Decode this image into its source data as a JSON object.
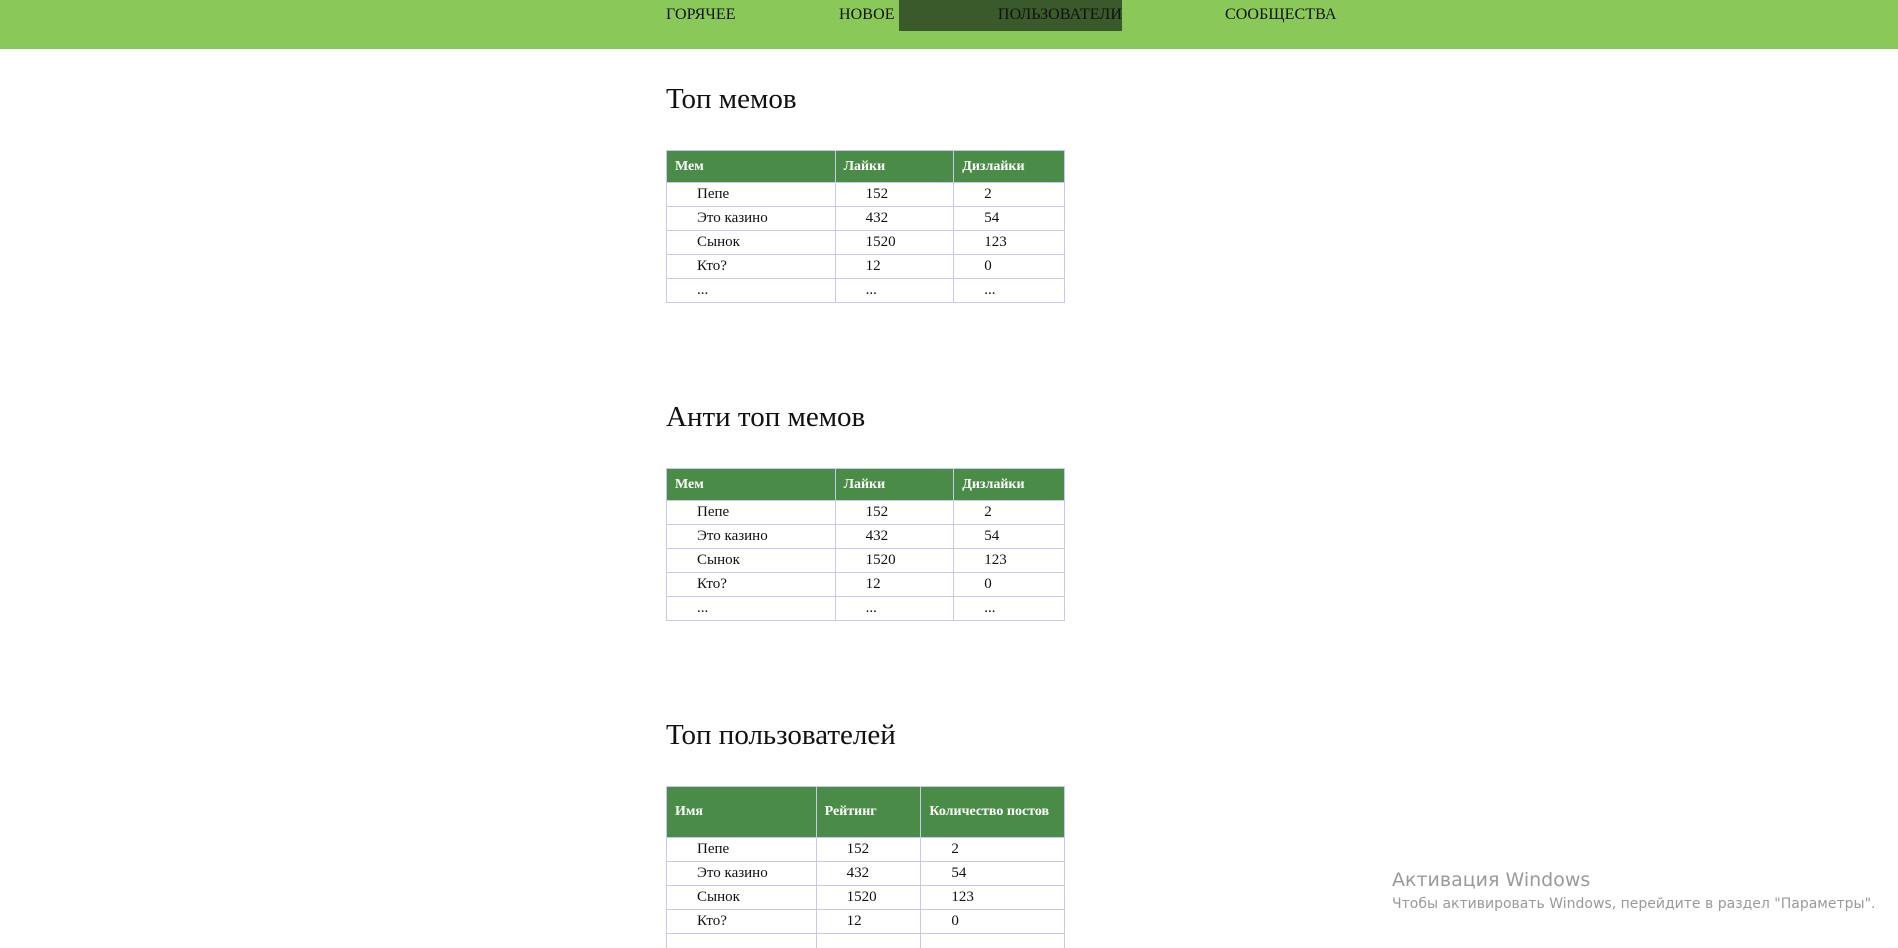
{
  "nav": {
    "items": [
      {
        "label": "ГОРЯЧЕЕ"
      },
      {
        "label": "НОВОЕ"
      },
      {
        "label": "ПОЛЬЗОВАТЕЛИ",
        "active": true
      },
      {
        "label": "СООБЩЕСТВА"
      }
    ],
    "bar_color": "#8ac85a",
    "active_color": "#3a5a2b"
  },
  "sections": [
    {
      "title": "Топ мемов",
      "headers": [
        "Мем",
        "Лайки",
        "Дизлайки"
      ],
      "rows": [
        [
          "Пепе",
          "152",
          "2"
        ],
        [
          "Это казино",
          "432",
          "54"
        ],
        [
          "Сынок",
          "1520",
          "123"
        ],
        [
          "Кто?",
          "12",
          "0"
        ],
        [
          "...",
          "...",
          "..."
        ]
      ]
    },
    {
      "title": "Анти топ мемов",
      "headers": [
        "Мем",
        "Лайки",
        "Дизлайки"
      ],
      "rows": [
        [
          "Пепе",
          "152",
          "2"
        ],
        [
          "Это казино",
          "432",
          "54"
        ],
        [
          "Сынок",
          "1520",
          "123"
        ],
        [
          "Кто?",
          "12",
          "0"
        ],
        [
          "...",
          "...",
          "..."
        ]
      ]
    },
    {
      "title": "Топ пользователей",
      "headers": [
        "Имя",
        "Рейтинг",
        "Количество постов"
      ],
      "rows": [
        [
          "Пепе",
          "152",
          "2"
        ],
        [
          "Это казино",
          "432",
          "54"
        ],
        [
          "Сынок",
          "1520",
          "123"
        ],
        [
          "Кто?",
          "12",
          "0"
        ],
        [
          "",
          "",
          ""
        ]
      ]
    }
  ],
  "table_header_color": "#4a8c47",
  "watermark": {
    "title": "Активация Windows",
    "subtitle": "Чтобы активировать Windows, перейдите в раздел \"Параметры\"."
  }
}
